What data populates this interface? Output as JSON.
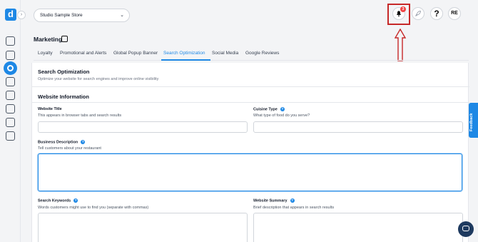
{
  "app": {
    "logo_letter": "d",
    "store": "Studio Sample Store",
    "notification_count": "3",
    "help_symbol": "?",
    "avatar_initials": "RE"
  },
  "header": {
    "title": "Marketing"
  },
  "tabs": [
    {
      "label": "Loyalty"
    },
    {
      "label": "Promotional and Alerts"
    },
    {
      "label": "Global Popup Banner"
    },
    {
      "label": "Search Optimization",
      "active": true
    },
    {
      "label": "Social Media"
    },
    {
      "label": "Google Reviews"
    }
  ],
  "seo": {
    "title": "Search Optimization",
    "subtitle": "Optimize your website for search engines and improve online visibility"
  },
  "website_info": {
    "title": "Website Information",
    "fields": {
      "website_title": {
        "label": "Website Title",
        "hint": "This appears in browser tabs and search results",
        "value": ""
      },
      "cuisine_type": {
        "label": "Cuisine Type",
        "hint": "What type of food do you serve?",
        "value": ""
      },
      "business_description": {
        "label": "Business Description",
        "hint": "Tell customers about your restaurant",
        "value": ""
      },
      "search_keywords": {
        "label": "Search Keywords",
        "hint": "Words customers might use to find you (separate with commas)",
        "value": ""
      },
      "website_summary": {
        "label": "Website Summary",
        "hint": "Brief description that appears in search results",
        "value": ""
      }
    }
  },
  "feedback_label": "Feedback",
  "colors": {
    "accent": "#1e88e5",
    "highlight": "#c62828",
    "badge": "#ef4444"
  }
}
